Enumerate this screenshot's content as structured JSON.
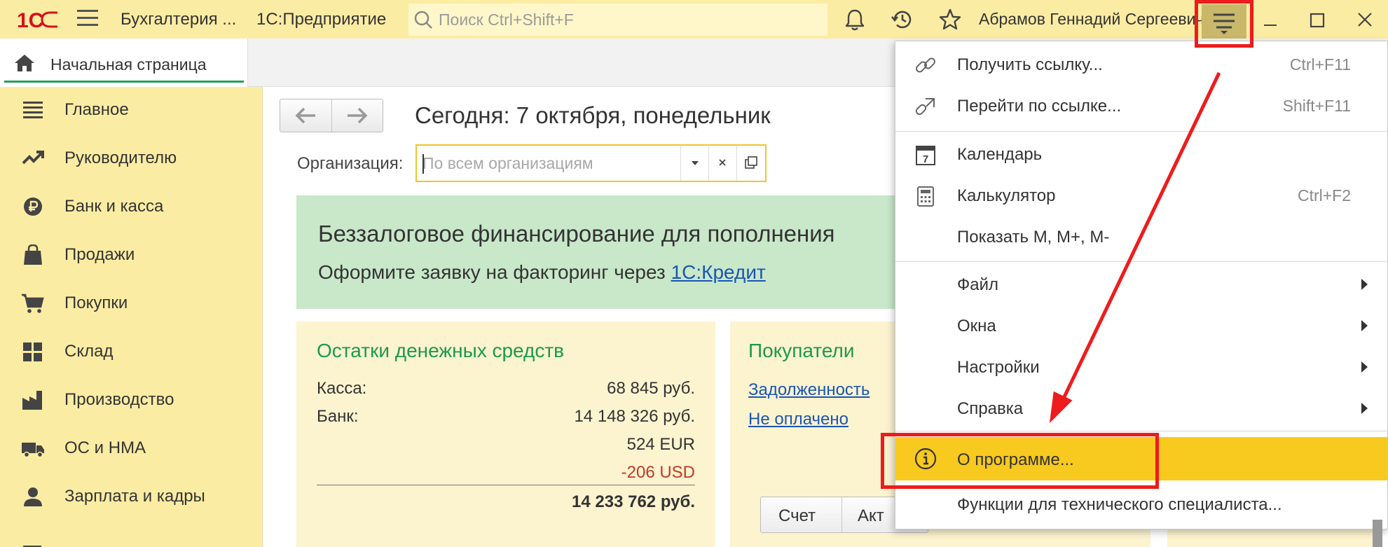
{
  "titlebar": {
    "logo_text": "1С",
    "app_title": "Бухгалтерия ...",
    "platform": "1С:Предприятие",
    "search_placeholder": "Поиск Ctrl+Shift+F",
    "user_name": "Абрамов Геннадий Сергеевич"
  },
  "tabs": {
    "home_label": "Начальная страница"
  },
  "sidebar": {
    "items": [
      {
        "label": "Главное",
        "icon": "list-icon"
      },
      {
        "label": "Руководителю",
        "icon": "trend-icon"
      },
      {
        "label": "Банк и касса",
        "icon": "ruble-coin-icon"
      },
      {
        "label": "Продажи",
        "icon": "shopping-bag-icon"
      },
      {
        "label": "Покупки",
        "icon": "cart-icon"
      },
      {
        "label": "Склад",
        "icon": "warehouse-grid-icon"
      },
      {
        "label": "Производство",
        "icon": "factory-icon"
      },
      {
        "label": "ОС и НМА",
        "icon": "truck-icon"
      },
      {
        "label": "Зарплата и кадры",
        "icon": "person-icon"
      }
    ]
  },
  "main": {
    "page_title": "Сегодня: 7 октября, понедельник",
    "org_label": "Организация:",
    "org_placeholder": "По всем организациям",
    "banner": {
      "title": "Беззалоговое финансирование для пополнения",
      "text": "Оформите заявку на факторинг через ",
      "link": "1С:Кредит"
    },
    "cash_card": {
      "title": "Остатки денежных средств",
      "kassa_label": "Касса:",
      "kassa_value": "68 845 руб.",
      "bank_label": "Банк:",
      "bank_value_rub": "14 148 326 руб.",
      "bank_value_eur": "524 EUR",
      "bank_value_usd": "-206 USD",
      "total": "14 233 762 руб."
    },
    "buyers_card": {
      "title": "Покупатели",
      "link_debt": "Задолженность",
      "link_unpaid": "Не оплачено",
      "btn_invoice": "Счет",
      "btn_act": "Акт"
    }
  },
  "dropdown": {
    "items": [
      {
        "label": "Получить ссылку...",
        "shortcut": "Ctrl+F11"
      },
      {
        "label": "Перейти по ссылке...",
        "shortcut": "Shift+F11"
      },
      {
        "label": "Календарь",
        "shortcut": ""
      },
      {
        "label": "Калькулятор",
        "shortcut": "Ctrl+F2"
      },
      {
        "label": "Показать M, M+, M-",
        "shortcut": ""
      },
      {
        "label": "Файл",
        "shortcut": ""
      },
      {
        "label": "Окна",
        "shortcut": ""
      },
      {
        "label": "Настройки",
        "shortcut": ""
      },
      {
        "label": "Справка",
        "shortcut": ""
      },
      {
        "label": "О программе...",
        "shortcut": ""
      },
      {
        "label": "Функции для технического специалиста...",
        "shortcut": ""
      }
    ],
    "calendar_icon_day": "7"
  },
  "colors": {
    "title_bg": "#fbeca3",
    "accent_green": "#1b9a4b",
    "highlight": "#f8c91e",
    "annotation_red": "#ee1c1c",
    "link_blue": "#1a55b5"
  }
}
